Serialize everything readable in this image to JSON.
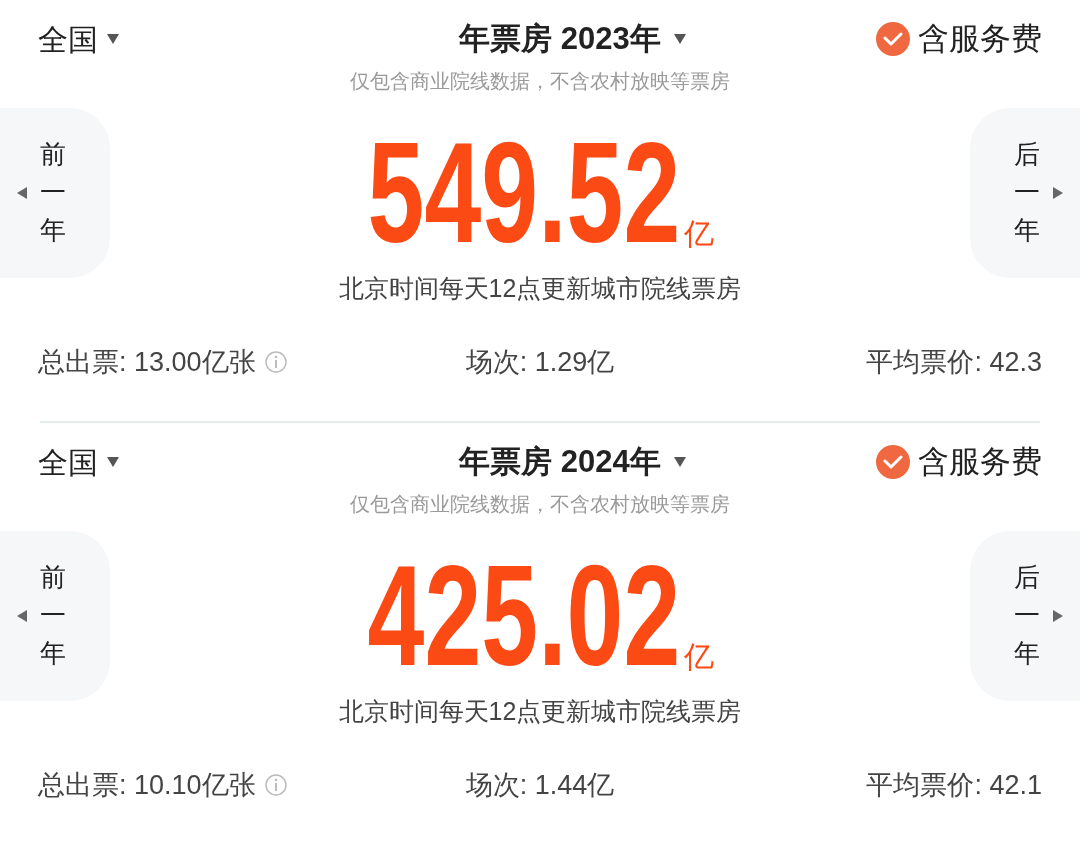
{
  "panels": [
    {
      "region": "全国",
      "title": "年票房 2023年",
      "service_fee": {
        "label": "含服务费",
        "checked": true
      },
      "note": "仅包含商业院线数据，不含农村放映等票房",
      "prev": "前一年",
      "next": "后一年",
      "amount": "549.52",
      "unit": "亿",
      "update_note": "北京时间每天12点更新城市院线票房",
      "stats": [
        {
          "label": "总出票: 13.00亿张",
          "info": true
        },
        {
          "label": "场次: 1.29亿",
          "info": false
        },
        {
          "label": "平均票价: 42.3",
          "info": false
        }
      ]
    },
    {
      "region": "全国",
      "title": "年票房 2024年",
      "service_fee": {
        "label": "含服务费",
        "checked": true
      },
      "note": "仅包含商业院线数据，不含农村放映等票房",
      "prev": "前一年",
      "next": "后一年",
      "amount": "425.02",
      "unit": "亿",
      "update_note": "北京时间每天12点更新城市院线票房",
      "stats": [
        {
          "label": "总出票: 10.10亿张",
          "info": true
        },
        {
          "label": "场次: 1.44亿",
          "info": false
        },
        {
          "label": "平均票价: 42.1",
          "info": false
        }
      ]
    }
  ]
}
